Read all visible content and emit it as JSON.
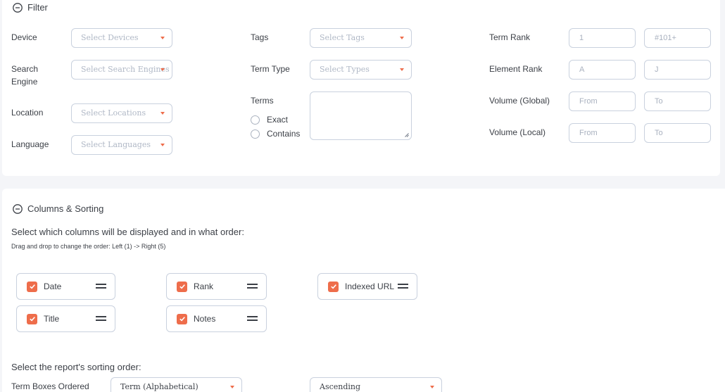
{
  "filter": {
    "title": "Filter",
    "device": {
      "label": "Device",
      "placeholder": "Select Devices"
    },
    "search_engine": {
      "label_line1": "Search",
      "label_line2": "Engine",
      "placeholder": "Select Search Engines"
    },
    "location": {
      "label": "Location",
      "placeholder": "Select Locations"
    },
    "language": {
      "label": "Language",
      "placeholder": "Select Languages"
    },
    "tags": {
      "label": "Tags",
      "placeholder": "Select Tags"
    },
    "term_type": {
      "label": "Term Type",
      "placeholder": "Select Types"
    },
    "terms": {
      "label": "Terms",
      "exact_label": "Exact",
      "contains_label": "Contains",
      "value": ""
    },
    "term_rank": {
      "label": "Term Rank",
      "from_placeholder": "1",
      "to_placeholder": "#101+"
    },
    "element_rank": {
      "label": "Element Rank",
      "from_placeholder": "A",
      "to_placeholder": "J"
    },
    "volume_global": {
      "label": "Volume (Global)",
      "from_placeholder": "From",
      "to_placeholder": "To"
    },
    "volume_local": {
      "label": "Volume (Local)",
      "from_placeholder": "From",
      "to_placeholder": "To"
    }
  },
  "columns": {
    "title": "Columns & Sorting",
    "heading": "Select which columns will be displayed and in what order:",
    "hint": "Drag and drop to change the order: Left (1) -> Right (5)",
    "items": [
      {
        "label": "Date",
        "checked": true
      },
      {
        "label": "Rank",
        "checked": true
      },
      {
        "label": "Indexed URL",
        "checked": true
      },
      {
        "label": "Title",
        "checked": true
      },
      {
        "label": "Notes",
        "checked": true
      }
    ],
    "sort_heading": "Select the report's sorting order:",
    "sort_label": "Term Boxes Ordered",
    "sort_by": "Term (Alphabetical)",
    "sort_direction": "Ascending"
  },
  "colors": {
    "accent": "#ee6d4b",
    "border": "#c9d1de",
    "background": "#f4f5f8"
  },
  "icons": {
    "collapse": "minus-circle-icon",
    "checkbox": "check-icon",
    "drag": "drag-handle-icon",
    "dropdown": "caret-down-icon"
  }
}
